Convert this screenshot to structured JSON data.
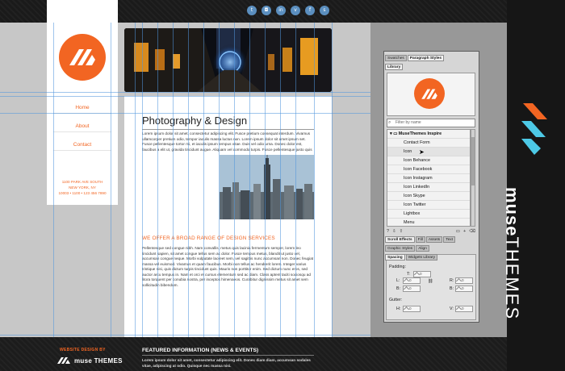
{
  "social": {
    "icons": [
      "twitter-icon",
      "instagram-icon",
      "linkedin-icon",
      "vimeo-icon",
      "facebook-icon",
      "skype-icon"
    ]
  },
  "site": {
    "nav": [
      "Home",
      "About",
      "Contact"
    ],
    "address": [
      "1100 PARK AVE SOUTH",
      "NEW YORK, NY",
      "10003 • 1100 • 123 456 7890"
    ],
    "heading": "Photography & Design",
    "para1": "Lorem ipsum dolor sit amet, consectetur adipiscing elit. Fusce pretium consequat interdum. Vivamus ullamcorper pretium odio, tempor iaculis massa luctus non. Lorem ipsum dolor sit amet ipsum set. Fusce pellentesque tortor mi, et iaculis ipsum tempus vitae. Duis vel odio urna. Donec dolor est, faucibus a elit ut, gravida tincidunt augue. Aliquam vel commodo turpis. Fusce pellentesque justo quis molestie aliquam. Donec elit dolor, ultrices sed nisl a, laoreet lobortis lorem. Sed rutrum aliquet urna fringilla commodo. Aliquam orci lectus, rutrum at enim et, congue auctor sapien. Vestibulum non interdum tellus. Etiam orci lacus, interdum vel mauris in, dignissim tempor nulla. Sed fermentum sodales massa sit amet imperdiet. Sed ullamcorper erat et ornare vehicula.",
    "subhead": "WE OFFER A BROAD RANGE OF DESIGN SERVICES",
    "para2": "Pellentesque sed congue nibh. Nam convallis, metus quis lacinia fermentum semper, lorem leo tincidunt sapien, sit amet congue tellus sem ac dolor. Fusce tempus metus, blandit ut justo vel, accumsan congue neque. Morbi vulputate laoreet sem, vel sagittis nunc accumsan non. Donec feugiat massa vel euismod. Vivamus et quam faucibus. Morbi non tellus ac hendrerit lorem. Integer varius tristique nisi, quis dictum turpis tincidunt quis. Mauris non porttitor enim. Sed dictum nunc eros, sed auctor arcu tempus in. Nam et orci et cursus elementum sed ac diam. Class aptent taciti sociosqu ad litora torquent per conubia nostra, per inceptos himenaeos. Curabitur dignissim metus sit amet sem sollicitudin bibendum.",
    "footer_design_label": "WEBSITE DESIGN BY",
    "footer_logo": "muse THEMES",
    "footer_heading": "FEATURED INFORMATION (NEWS & EVENTS)",
    "footer_text": "Lorem ipsum dolor sit amet, consectetur adipiscing elit. Donec diam diam, accumsan sodales vitae, adipiscing at odio. Quisque nec massa nisi."
  },
  "panel": {
    "top_tabs": [
      "Swatches",
      "Paragraph Styles"
    ],
    "library_tab": "Library",
    "filter_placeholder": "Filter by name",
    "folder": "MuseThemes Inspire",
    "items": [
      "Contact Form",
      "Icon",
      "Icon Behance",
      "Icon Facebook",
      "Icon Instagram",
      "Icon LinkedIn",
      "Icon Skype",
      "Icon Twitter",
      "Lightbox",
      "Menu"
    ],
    "tabs2": [
      "Scroll Effects",
      "Fill",
      "Assets",
      "Text"
    ],
    "tabs3": [
      "Graphic Styles",
      "Align"
    ],
    "tabs4": [
      "Spacing",
      "Widgets Library"
    ],
    "padding_label": "Padding:",
    "gutter_label": "Gutter:",
    "field_labels": {
      "L": "L:",
      "R": "R:",
      "B": "B:",
      "H": "H:",
      "V": "V:"
    },
    "field_value": "0"
  },
  "brand": {
    "muse": "muse",
    "themes": "THEMES"
  },
  "colors": {
    "accent": "#f26522",
    "panel": "#d6d6d6",
    "guide": "#5096dc"
  }
}
